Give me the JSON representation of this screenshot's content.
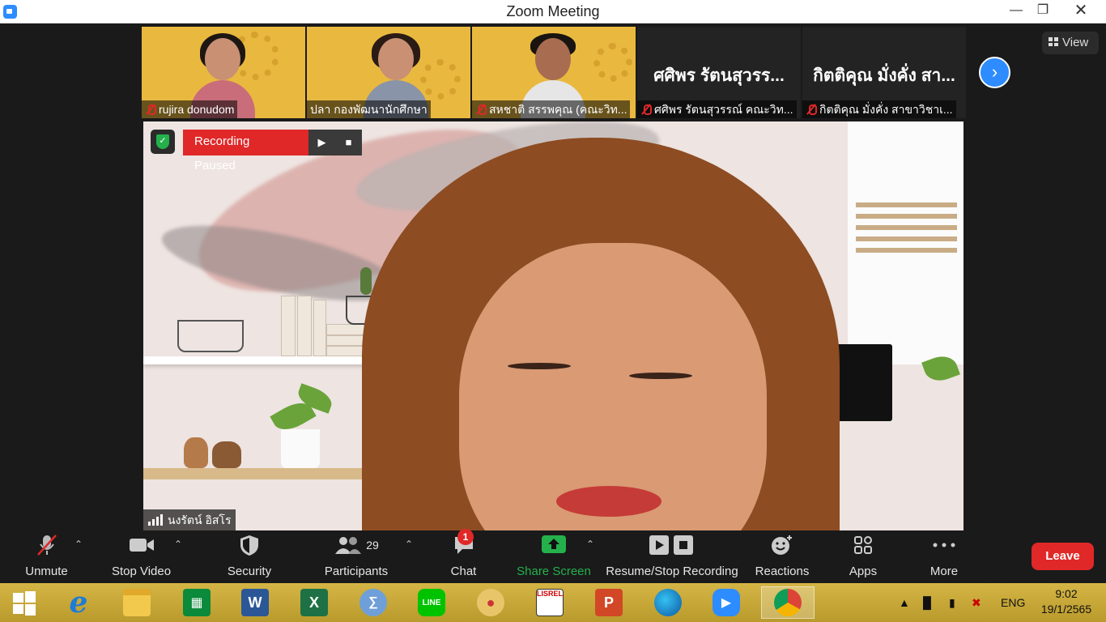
{
  "window": {
    "title": "Zoom Meeting",
    "minimize_icon": "minimize-icon",
    "maximize_icon": "maximize-icon",
    "close_icon": "close-icon"
  },
  "view_button": {
    "label": "View"
  },
  "thumbnails": [
    {
      "caption": "rujira donudom",
      "muted": true,
      "big_name": ""
    },
    {
      "caption": "ปลา กองพัฒนานักศึกษา",
      "muted": false,
      "big_name": ""
    },
    {
      "caption": "สหชาติ สรรพคุณ (คณะวิท...",
      "muted": true,
      "big_name": ""
    },
    {
      "caption": "ศศิพร รัตนสุวรรณ์ คณะวิท...",
      "muted": true,
      "big_name": "ศศิพร รัตนสุวรร..."
    },
    {
      "caption": "กิตติคุณ มั่งคั่ง สาขาวิชาเ...",
      "muted": true,
      "big_name": "กิตติคุณ มั่งคั่ง สา..."
    }
  ],
  "speaker": {
    "name": "นงรัตน์ อิสโร",
    "recording_status": "Recording Paused"
  },
  "toolbar": {
    "unmute": "Unmute",
    "stop_video": "Stop Video",
    "security": "Security",
    "participants": "Participants",
    "participants_count": "29",
    "chat": "Chat",
    "chat_badge": "1",
    "share_screen": "Share Screen",
    "recording": "Resume/Stop Recording",
    "reactions": "Reactions",
    "apps": "Apps",
    "more": "More",
    "leave": "Leave"
  },
  "taskbar": {
    "language": "ENG",
    "time": "9:02",
    "date": "19/1/2565",
    "apps": [
      "start-icon",
      "internet-explorer-icon",
      "file-explorer-icon",
      "store-icon",
      "word-icon",
      "excel-icon",
      "math-input-icon",
      "line-icon",
      "paint-icon",
      "lisrel-icon",
      "powerpoint-icon",
      "edge-icon",
      "zoom-icon",
      "chrome-icon"
    ],
    "lisrel_label": "LISREL"
  },
  "colors": {
    "accent_blue": "#2d8cff",
    "leave_red": "#e02828",
    "share_green": "#24b14c",
    "taskbar_gold": "#c8a83a"
  }
}
